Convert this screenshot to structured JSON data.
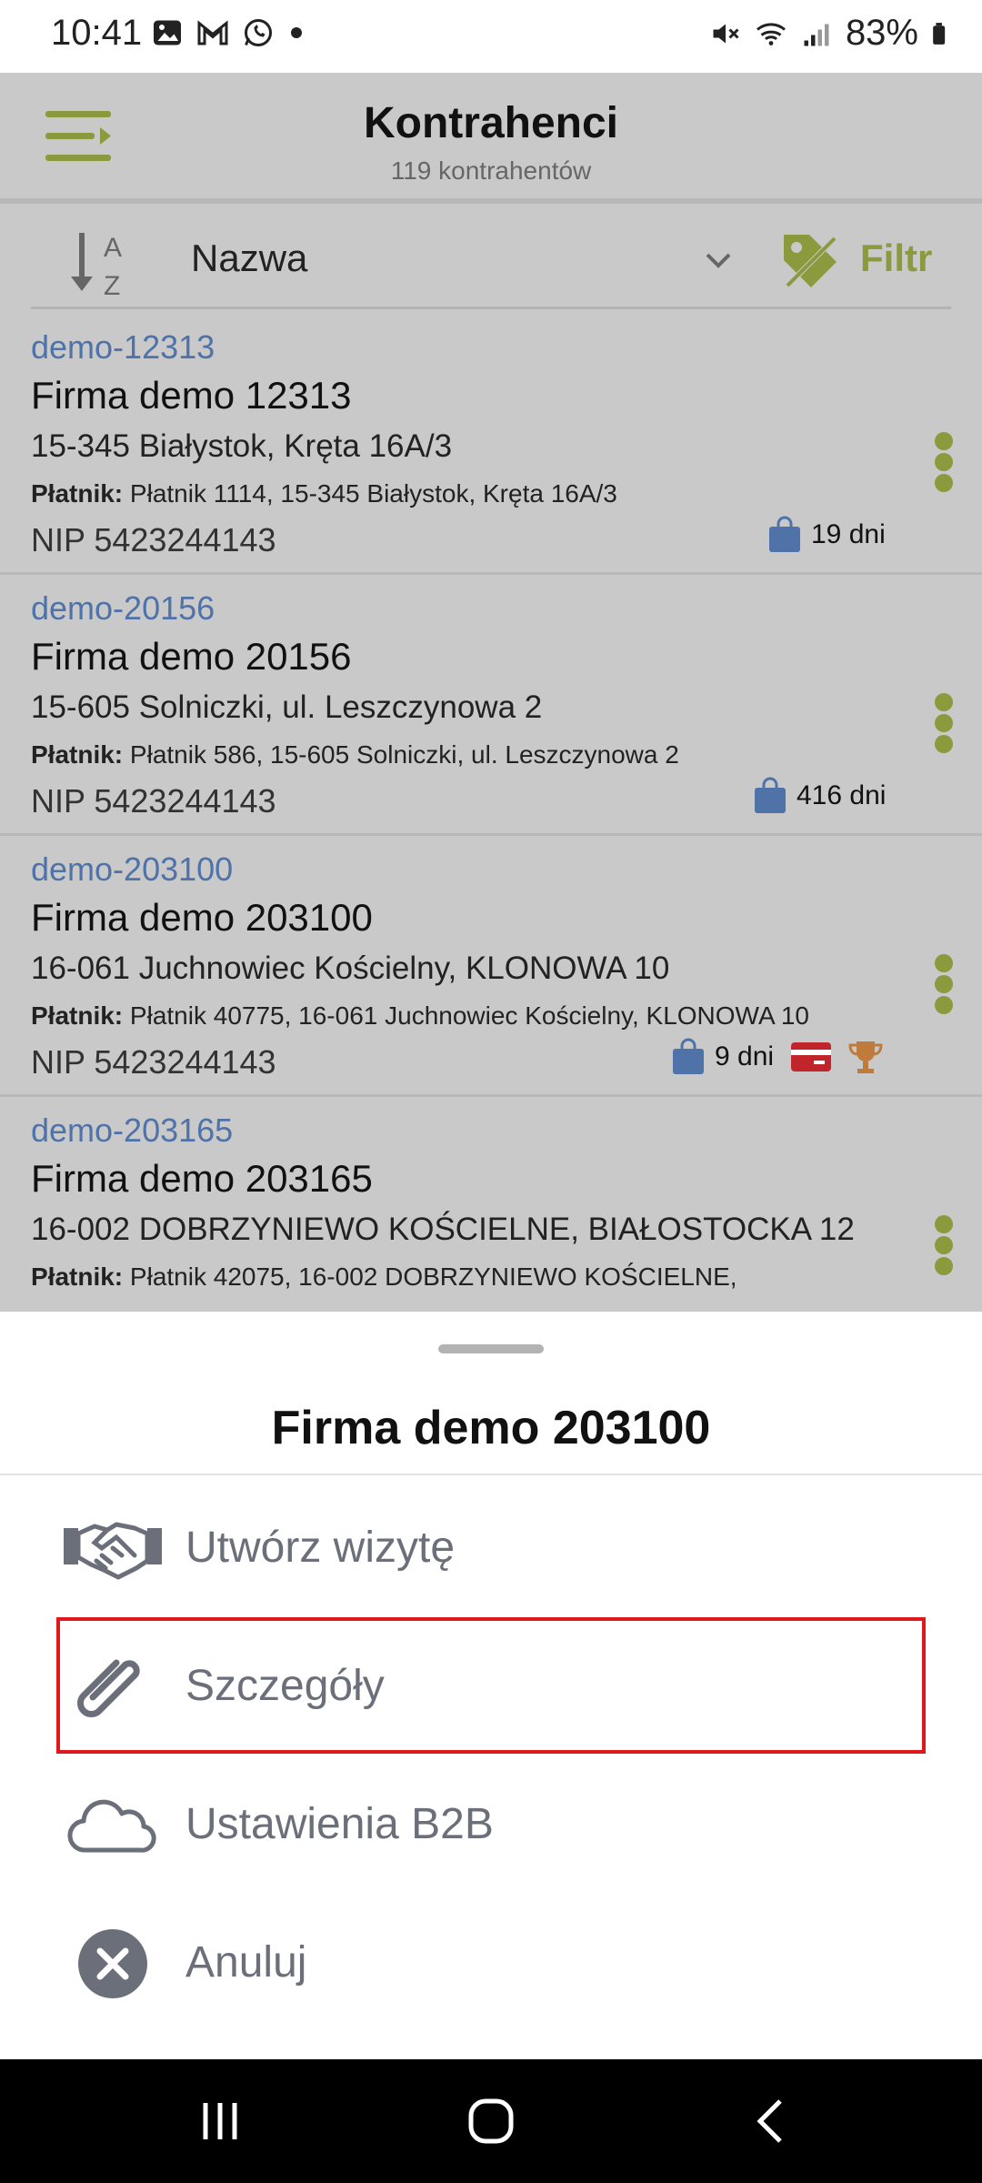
{
  "status_bar": {
    "time": "10:41",
    "battery": "83%",
    "left_icons": [
      "gallery-icon",
      "gmail-icon",
      "whatsapp-icon",
      "dot-icon"
    ],
    "right_icons": [
      "mute-icon",
      "wifi-icon",
      "signal-icon",
      "battery-icon"
    ]
  },
  "header": {
    "title": "Kontrahenci",
    "subtitle": "119 kontrahentów"
  },
  "sort_bar": {
    "sort_label": "Nazwa",
    "filter_label": "Filtr"
  },
  "contractors": [
    {
      "code": "demo-12313",
      "name": "Firma demo 12313",
      "address": "15-345 Białystok, Kręta 16A/3",
      "payer_label": "Płatnik:",
      "payer": "Płatnik 1114, 15-345 Białystok, Kręta 16A/3",
      "nip": "NIP 5423244143",
      "days": "19 dni",
      "has_card": false,
      "has_trophy": false
    },
    {
      "code": "demo-20156",
      "name": "Firma demo 20156",
      "address": "15-605 Solniczki, ul. Leszczynowa 2",
      "payer_label": "Płatnik:",
      "payer": "Płatnik 586, 15-605 Solniczki, ul. Leszczynowa 2",
      "nip": "NIP 5423244143",
      "days": "416 dni",
      "has_card": false,
      "has_trophy": false
    },
    {
      "code": "demo-203100",
      "name": "Firma demo 203100",
      "address": "16-061 Juchnowiec Kościelny, KLONOWA 10",
      "payer_label": "Płatnik:",
      "payer": "Płatnik 40775, 16-061 Juchnowiec Kościelny, KLONOWA 10",
      "nip": "NIP 5423244143",
      "days": "9 dni",
      "has_card": true,
      "has_trophy": true
    },
    {
      "code": "demo-203165",
      "name": "Firma demo 203165",
      "address": "16-002 DOBRZYNIEWO KOŚCIELNE, BIAŁOSTOCKA 12",
      "payer_label": "Płatnik:",
      "payer": "Płatnik 42075, 16-002 DOBRZYNIEWO KOŚCIELNE,",
      "nip": "",
      "days": "",
      "has_card": false,
      "has_trophy": false
    }
  ],
  "sheet": {
    "title": "Firma demo 203100",
    "actions": [
      {
        "label": "Utwórz wizytę",
        "icon": "handshake-icon"
      },
      {
        "label": "Szczegóły",
        "icon": "paperclip-icon"
      },
      {
        "label": "Ustawienia B2B",
        "icon": "cloud-icon"
      },
      {
        "label": "Anuluj",
        "icon": "close-circle-icon"
      }
    ]
  },
  "colors": {
    "accent_olive": "#8a9a3c",
    "link_blue": "#4f72a8",
    "highlight_red": "#e0181c",
    "dim_overlay": "#c9c9c9"
  }
}
